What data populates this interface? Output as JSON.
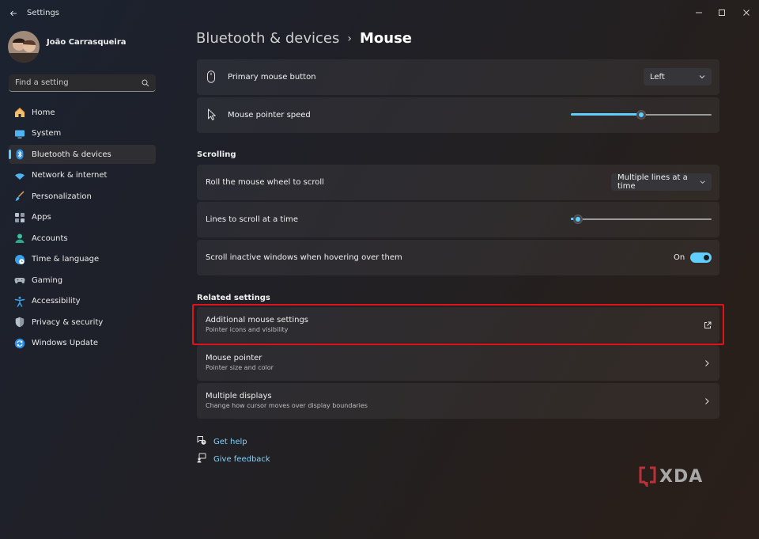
{
  "window": {
    "title": "Settings"
  },
  "profile": {
    "name": "João Carrasqueira"
  },
  "search": {
    "placeholder": "Find a setting"
  },
  "nav": [
    {
      "label": "Home",
      "icon": "home-icon"
    },
    {
      "label": "System",
      "icon": "system-icon"
    },
    {
      "label": "Bluetooth & devices",
      "icon": "bluetooth-icon",
      "active": true
    },
    {
      "label": "Network & internet",
      "icon": "wifi-icon"
    },
    {
      "label": "Personalization",
      "icon": "brush-icon"
    },
    {
      "label": "Apps",
      "icon": "apps-icon"
    },
    {
      "label": "Accounts",
      "icon": "account-icon"
    },
    {
      "label": "Time & language",
      "icon": "globe-clock-icon"
    },
    {
      "label": "Gaming",
      "icon": "gamepad-icon"
    },
    {
      "label": "Accessibility",
      "icon": "accessibility-icon"
    },
    {
      "label": "Privacy & security",
      "icon": "shield-icon"
    },
    {
      "label": "Windows Update",
      "icon": "update-icon"
    }
  ],
  "breadcrumb": {
    "parent": "Bluetooth & devices",
    "separator": "›",
    "current": "Mouse"
  },
  "settings": {
    "primary_button": {
      "label": "Primary mouse button",
      "value": "Left"
    },
    "pointer_speed": {
      "label": "Mouse pointer speed",
      "level": 0.5
    },
    "scrolling_header": "Scrolling",
    "roll_wheel": {
      "label": "Roll the mouse wheel to scroll",
      "value": "Multiple lines at a time"
    },
    "lines_to_scroll": {
      "label": "Lines to scroll at a time",
      "level": 0.05
    },
    "scroll_inactive": {
      "label": "Scroll inactive windows when hovering over them",
      "state": "On"
    }
  },
  "related": {
    "header": "Related settings",
    "items": [
      {
        "title": "Additional mouse settings",
        "subtitle": "Pointer icons and visibility",
        "icon": "external-link-icon"
      },
      {
        "title": "Mouse pointer",
        "subtitle": "Pointer size and color",
        "icon": "chevron-right-icon"
      },
      {
        "title": "Multiple displays",
        "subtitle": "Change how cursor moves over display boundaries",
        "icon": "chevron-right-icon"
      }
    ]
  },
  "links": {
    "help": "Get help",
    "feedback": "Give feedback"
  },
  "watermark": {
    "text": "XDA"
  },
  "colors": {
    "accent": "#60cdff",
    "highlight": "#e0121b"
  }
}
